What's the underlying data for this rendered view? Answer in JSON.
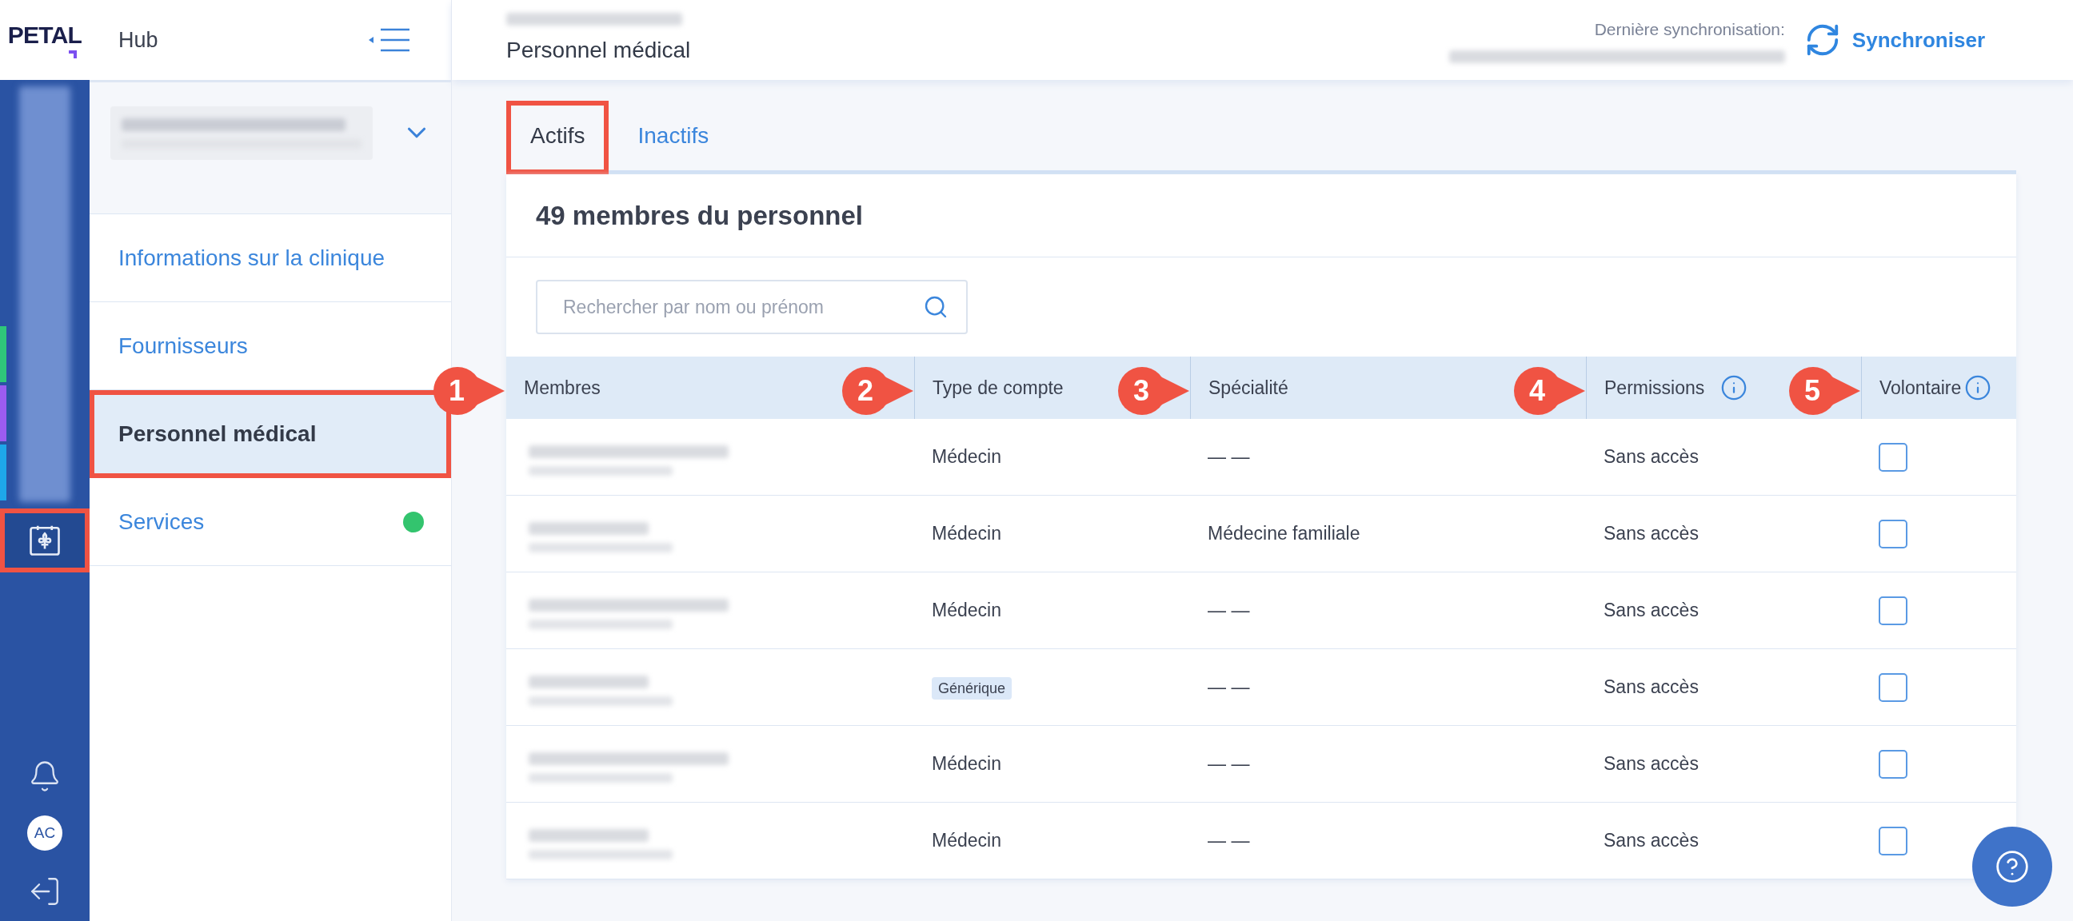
{
  "logo": "PETAL",
  "rail": {
    "markers": [
      {
        "color": "#2fc77a"
      },
      {
        "color": "#9b5cf0"
      },
      {
        "color": "#1ea7ea"
      }
    ],
    "calendar_highlighted": true,
    "avatar": "AC"
  },
  "sidebar": {
    "title": "Hub",
    "items": [
      {
        "label": "Informations sur la clinique",
        "selected": false,
        "highlighted": false,
        "dot": false
      },
      {
        "label": "Fournisseurs",
        "selected": false,
        "highlighted": false,
        "dot": false
      },
      {
        "label": "Personnel médical",
        "selected": true,
        "highlighted": true,
        "dot": false
      },
      {
        "label": "Services",
        "selected": false,
        "highlighted": false,
        "dot": true
      }
    ]
  },
  "header": {
    "title": "Personnel médical",
    "sync_label": "Dernière synchronisation:",
    "sync_button": "Synchroniser"
  },
  "tabs": [
    {
      "label": "Actifs",
      "selected": true,
      "highlighted": true
    },
    {
      "label": "Inactifs",
      "selected": false,
      "highlighted": false
    }
  ],
  "card": {
    "title": "49 membres du personnel",
    "search": {
      "placeholder": "Rechercher par nom ou prénom"
    }
  },
  "table": {
    "columns": [
      {
        "label": "Membres",
        "callout": "1",
        "info": false
      },
      {
        "label": "Type de compte",
        "callout": "2",
        "info": false
      },
      {
        "label": "Spécialité",
        "callout": "3",
        "info": false
      },
      {
        "label": "Permissions",
        "callout": "4",
        "info": true
      },
      {
        "label": "Volontaire",
        "callout": "5",
        "info": true
      }
    ],
    "rows": [
      {
        "type": {
          "kind": "text",
          "text": "Médecin"
        },
        "specialty": "— —",
        "permission": "Sans accès",
        "volunteer": false
      },
      {
        "type": {
          "kind": "text",
          "text": "Médecin"
        },
        "specialty": "Médecine familiale",
        "permission": "Sans accès",
        "volunteer": false
      },
      {
        "type": {
          "kind": "text",
          "text": "Médecin"
        },
        "specialty": "— —",
        "permission": "Sans accès",
        "volunteer": false
      },
      {
        "type": {
          "kind": "tag",
          "text": "Générique"
        },
        "specialty": "— —",
        "permission": "Sans accès",
        "volunteer": false
      },
      {
        "type": {
          "kind": "text",
          "text": "Médecin"
        },
        "specialty": "— —",
        "permission": "Sans accès",
        "volunteer": false
      },
      {
        "type": {
          "kind": "text",
          "text": "Médecin"
        },
        "specialty": "— —",
        "permission": "Sans accès",
        "volunteer": false
      }
    ]
  }
}
